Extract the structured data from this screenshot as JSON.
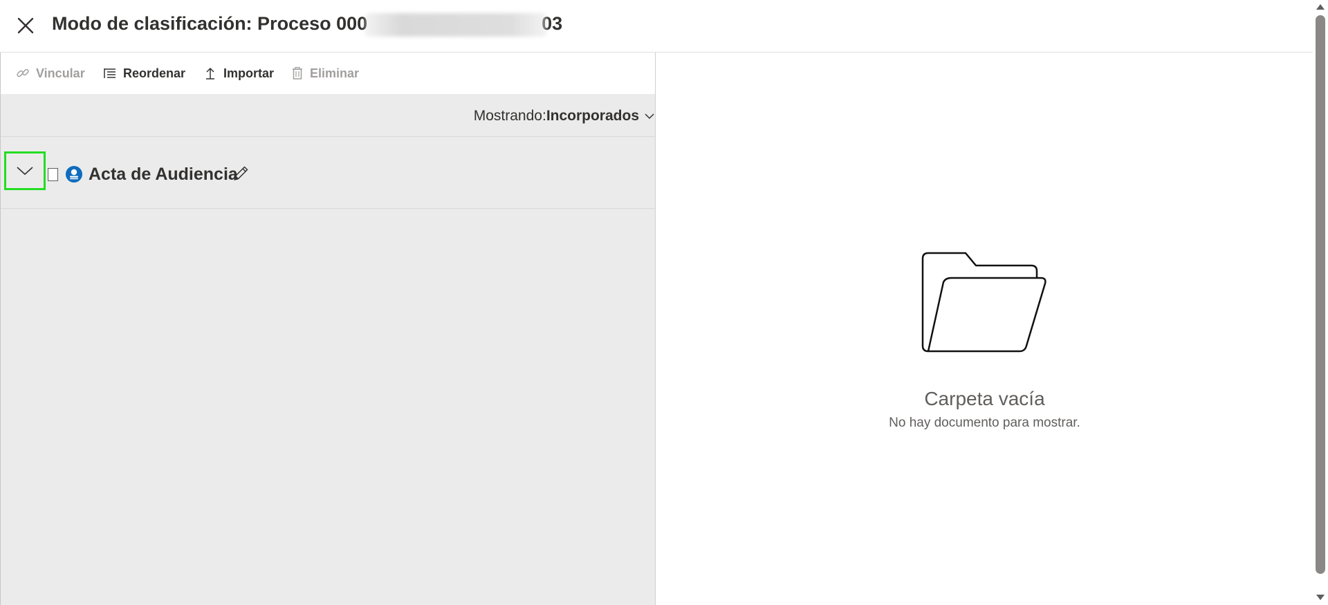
{
  "header": {
    "close_icon": "close-icon",
    "title_prefix": "Modo de clasificación: Proceso 000",
    "title_suffix": "03"
  },
  "toolbar": {
    "buttons": [
      {
        "label": "Vincular",
        "icon": "link-icon",
        "enabled": false
      },
      {
        "label": "Reordenar",
        "icon": "list-icon",
        "enabled": true
      },
      {
        "label": "Importar",
        "icon": "upload-icon",
        "enabled": true
      },
      {
        "label": "Eliminar",
        "icon": "trash-icon",
        "enabled": false
      }
    ]
  },
  "filter": {
    "label": "Mostrando:",
    "value": "Incorporados"
  },
  "tree": {
    "items": [
      {
        "label": "Acta de Audiencia",
        "icon": "user-badge-icon",
        "expanded": false,
        "checked": false
      }
    ]
  },
  "empty_state": {
    "icon": "folder-open-icon",
    "title": "Carpeta vacía",
    "subtitle": "No hay documento para mostrar."
  },
  "colors": {
    "accent": "#0f6cbd",
    "highlight": "#22dd22",
    "pane_bg": "#ebebeb"
  }
}
